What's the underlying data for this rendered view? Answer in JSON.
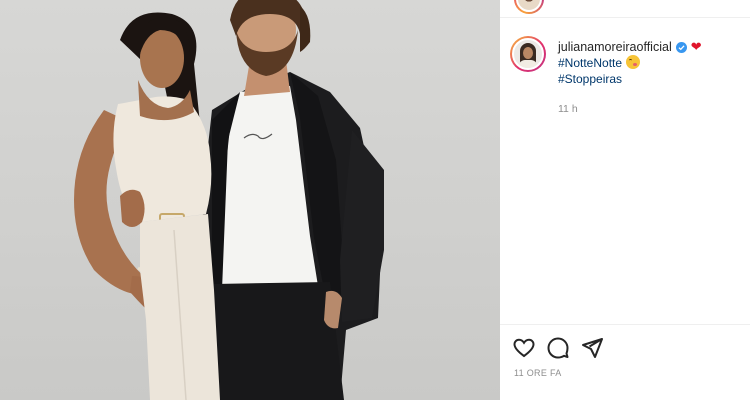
{
  "photo": {
    "alt_people": "couple-photo"
  },
  "post": {
    "username": "julianamoreiraofficial",
    "verified": true,
    "caption_tags": [
      "#NotteNotte",
      "#Stoppeiras"
    ],
    "relative_time": "11 h",
    "post_age": "11 ORE FA"
  },
  "icons": {
    "verified": "verified-badge-icon",
    "heart_emoji": "red-heart-emoji",
    "kiss_emoji": "kissing-face-emoji",
    "like": "heart-outline-icon",
    "comment": "comment-bubble-icon",
    "share": "paper-plane-icon"
  },
  "colors": {
    "link": "#00376b",
    "muted": "#8e8e8e",
    "verified": "#3897f0",
    "heart": "#e0142b"
  }
}
